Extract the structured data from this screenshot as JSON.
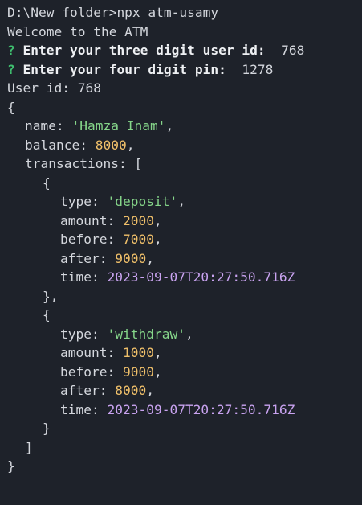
{
  "cmd": "D:\\New folder>npx atm-usamy",
  "welcome": "Welcome to the ATM",
  "q_mark": "?",
  "q1_text": "Enter your three digit user id:",
  "q1_answer": "768",
  "q2_text": "Enter your four digit pin:",
  "q2_answer": "1278",
  "userid_line": "User id: 768",
  "obj": {
    "name_key": "name: ",
    "name_val": "'Hamza Inam'",
    "balance_key": "balance: ",
    "balance_val": "8000",
    "transactions_key": "transactions: ["
  },
  "transactions": [
    {
      "type": "'deposit'",
      "amount": "2000",
      "before": "7000",
      "after": "9000",
      "time": "2023-09-07T20:27:50.716Z"
    },
    {
      "type": "'withdraw'",
      "amount": "1000",
      "before": "9000",
      "after": "8000",
      "time": "2023-09-07T20:27:50.716Z"
    }
  ],
  "keys": {
    "type": "type: ",
    "amount": "amount: ",
    "before": "before: ",
    "after": "after: ",
    "time": "time: "
  },
  "punct": {
    "open_brace": "{",
    "close_brace": "}",
    "close_obj_comma": "},",
    "close_bracket": "]",
    "comma": ","
  },
  "colors": {
    "background": "#1e222a",
    "text": "#d4d7dd",
    "prompt": "#3fbf6f",
    "string": "#86d68a",
    "number": "#f0c06a",
    "date": "#c9a3f0"
  }
}
